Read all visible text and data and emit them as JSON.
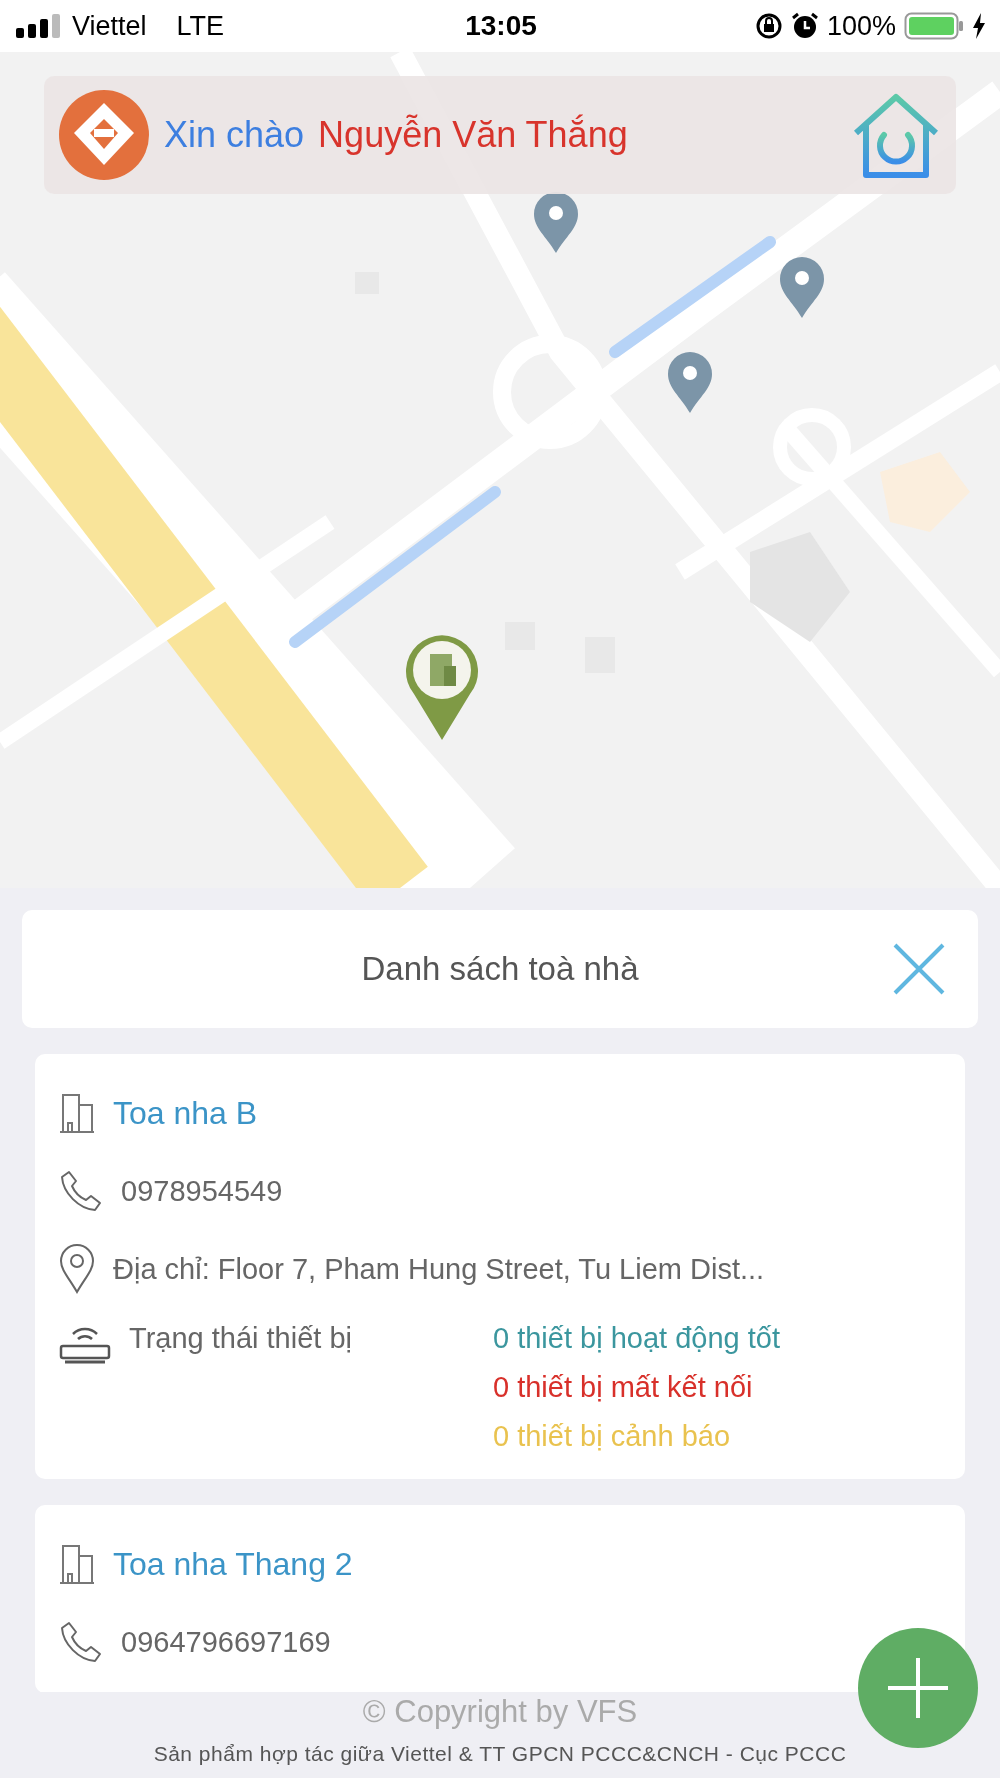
{
  "status_bar": {
    "carrier": "Viettel",
    "network": "LTE",
    "time": "13:05",
    "battery": "100%"
  },
  "header": {
    "greeting": "Xin chào",
    "user": "Nguyễn Văn Thắng"
  },
  "panel": {
    "title": "Danh sách toà nhà"
  },
  "buildings": [
    {
      "name": "Toa nha B",
      "phone": "0978954549",
      "address": "Địa chỉ: Floor 7, Pham Hung Street, Tu Liem Dist...",
      "status_label": "Trạng thái thiết bị",
      "statuses": [
        {
          "text": "0 thiết bị hoạt động tốt",
          "color": "#3b969e"
        },
        {
          "text": "0 thiết bị mất kết nối",
          "color": "#d8302a"
        },
        {
          "text": "0 thiết bị cảnh báo",
          "color": "#e9c24e"
        }
      ]
    },
    {
      "name": "Toa nha Thang 2",
      "phone": "0964796697169"
    }
  ],
  "footer": {
    "copyright": "© Copyright by VFS",
    "credit": "Sản phẩm hợp tác giữa Viettel & TT GPCN PCCC&CNCH - Cục PCCC"
  }
}
